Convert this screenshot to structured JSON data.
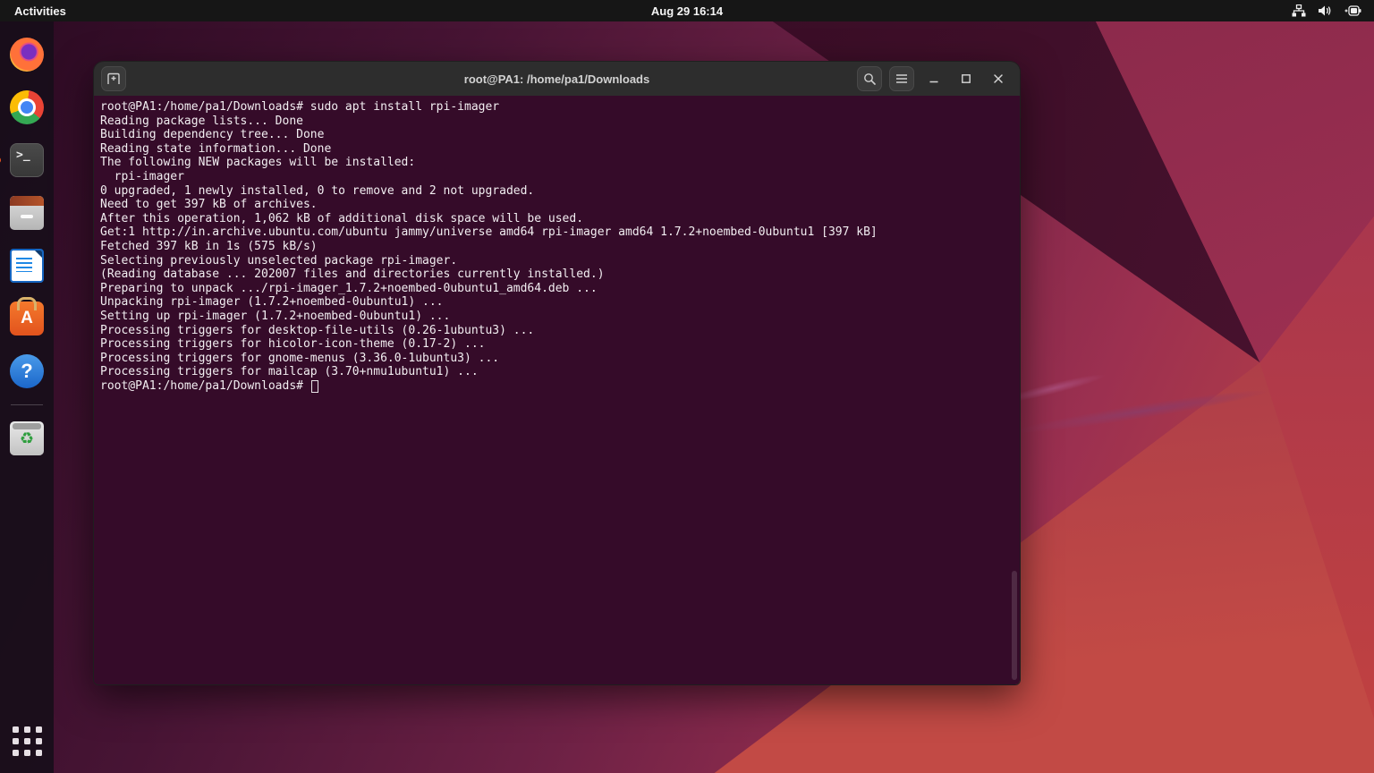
{
  "topbar": {
    "activities": "Activities",
    "clock": "Aug 29 16:14"
  },
  "dock": {
    "running_indicator_color": "#E95420",
    "terminal_glyph": ">_",
    "software_glyph": "A",
    "help_glyph": "?",
    "trash_glyph": "♻",
    "icons": [
      "firefox",
      "chrome",
      "terminal",
      "files",
      "libreoffice-writer",
      "ubuntu-software",
      "help",
      "trash",
      "app-grid"
    ]
  },
  "window": {
    "title": "root@PA1: /home/pa1/Downloads",
    "controls": [
      "new-tab",
      "search",
      "menu",
      "minimize",
      "maximize",
      "close"
    ]
  },
  "terminal": {
    "lines": [
      "root@PA1:/home/pa1/Downloads# sudo apt install rpi-imager",
      "Reading package lists... Done",
      "Building dependency tree... Done",
      "Reading state information... Done",
      "The following NEW packages will be installed:",
      "  rpi-imager",
      "0 upgraded, 1 newly installed, 0 to remove and 2 not upgraded.",
      "Need to get 397 kB of archives.",
      "After this operation, 1,062 kB of additional disk space will be used.",
      "Get:1 http://in.archive.ubuntu.com/ubuntu jammy/universe amd64 rpi-imager amd64 1.7.2+noembed-0ubuntu1 [397 kB]",
      "Fetched 397 kB in 1s (575 kB/s)",
      "Selecting previously unselected package rpi-imager.",
      "(Reading database ... 202007 files and directories currently installed.)",
      "Preparing to unpack .../rpi-imager_1.7.2+noembed-0ubuntu1_amd64.deb ...",
      "Unpacking rpi-imager (1.7.2+noembed-0ubuntu1) ...",
      "Setting up rpi-imager (1.7.2+noembed-0ubuntu1) ...",
      "Processing triggers for desktop-file-utils (0.26-1ubuntu3) ...",
      "Processing triggers for hicolor-icon-theme (0.17-2) ...",
      "Processing triggers for gnome-menus (3.36.0-1ubuntu3) ...",
      "Processing triggers for mailcap (3.70+nmu1ubuntu1) ..."
    ],
    "prompt": "root@PA1:/home/pa1/Downloads# "
  },
  "colors": {
    "terminal_bg": "#350b29",
    "header_bg": "#2d2d2d",
    "topbar_bg": "#161616",
    "accent": "#E95420"
  }
}
